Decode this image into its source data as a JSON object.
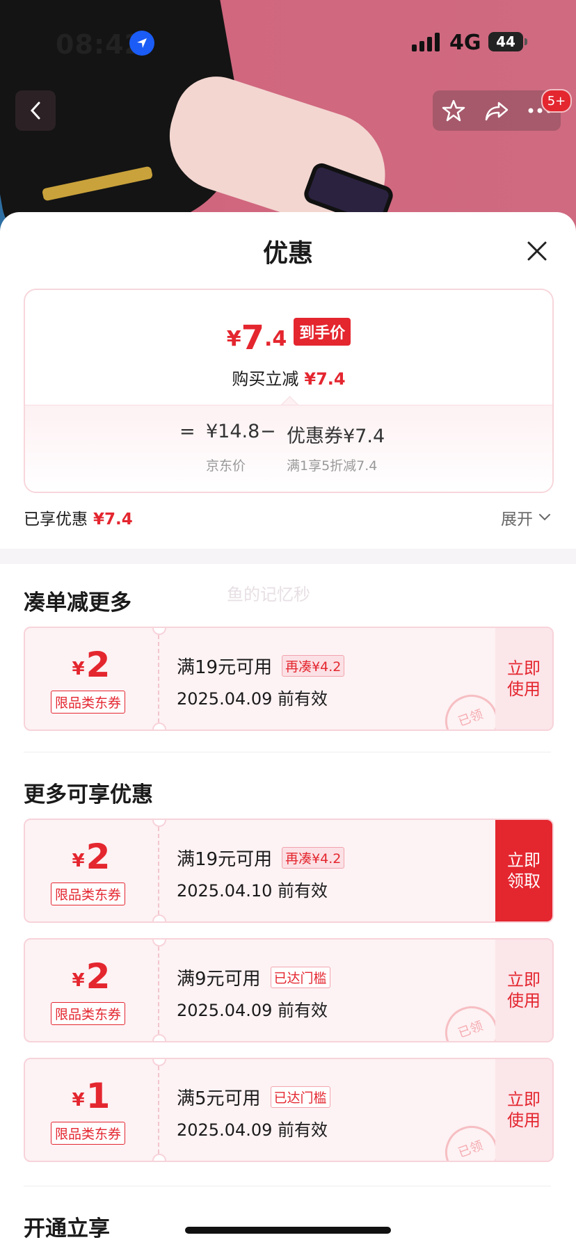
{
  "status": {
    "time": "08:42",
    "network": "4G",
    "battery": "44"
  },
  "top": {
    "badge": "5+"
  },
  "sheet": {
    "title": "优惠",
    "price": {
      "currency": "¥",
      "final_int": "7",
      "final_dec": ".4",
      "final_tag": "到手价",
      "reduce_label": "购买立减",
      "reduce_value": "¥7.4",
      "eq": "=",
      "jd_price": "¥14.8",
      "minus": "−",
      "coupon_part": "优惠券¥7.4",
      "jd_label": "京东价",
      "coupon_desc": "满1享5折减7.4"
    },
    "saved_label": "已享优惠",
    "saved_value": "¥7.4",
    "expand_label": "展开"
  },
  "watermark": "鱼的记忆秒",
  "sections": {
    "combo": "凑单减更多",
    "more": "更多可享优惠",
    "open": "开通立享"
  },
  "coupons": [
    {
      "currency": "¥",
      "amount": "2",
      "type": "限品类东券",
      "cond": "满19元可用",
      "chip": "再凑¥4.2",
      "valid": "2025.04.09 前有效",
      "action": "立即\n使用",
      "stamp": "已领"
    },
    {
      "currency": "¥",
      "amount": "2",
      "type": "限品类东券",
      "cond": "满19元可用",
      "chip": "再凑¥4.2",
      "valid": "2025.04.10 前有效",
      "action": "立即\n领取",
      "stamp": ""
    },
    {
      "currency": "¥",
      "amount": "2",
      "type": "限品类东券",
      "cond": "满9元可用",
      "chip": "已达门槛",
      "valid": "2025.04.09 前有效",
      "action": "立即\n使用",
      "stamp": "已领"
    },
    {
      "currency": "¥",
      "amount": "1",
      "type": "限品类东券",
      "cond": "满5元可用",
      "chip": "已达门槛",
      "valid": "2025.04.09 前有效",
      "action": "立即\n使用",
      "stamp": "已领"
    }
  ],
  "colors": {
    "accent": "#e4262f",
    "card_bg": "#fdf2f4",
    "border": "#f7d3da"
  },
  "icons": [
    "location-arrow-icon",
    "back-chevron-icon",
    "star-icon",
    "share-icon",
    "more-icon",
    "close-icon",
    "chevron-down-icon"
  ]
}
